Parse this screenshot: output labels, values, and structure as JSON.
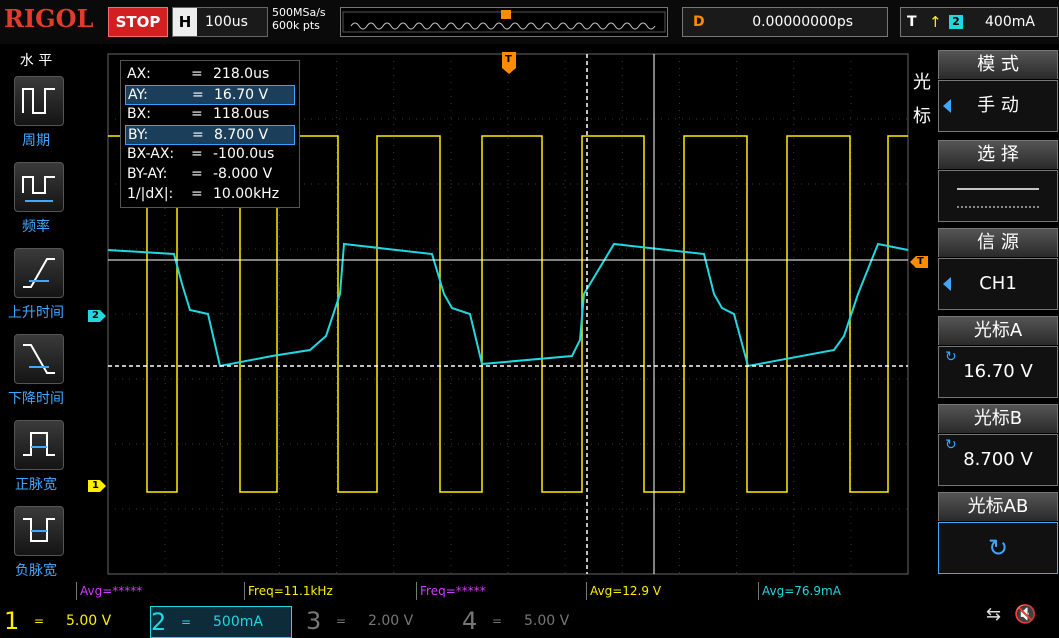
{
  "brand": {
    "logo": "RIGOL"
  },
  "top": {
    "run_state": "STOP",
    "horizontal_label": "H",
    "timebase": "100us",
    "sample_rate": "500MSa/s",
    "memory_depth": "600k pts",
    "delay_label": "D",
    "delay_value": "0.00000000ps",
    "trigger_label": "T",
    "trigger_channel": "2",
    "trigger_level": "400mA",
    "trigger_edge_icon": "rising-edge-icon"
  },
  "left_panel": {
    "title": "水 平",
    "items": [
      {
        "label": "周期",
        "icon": "period-icon"
      },
      {
        "label": "频率",
        "icon": "frequency-icon"
      },
      {
        "label": "上升时间",
        "icon": "rise-time-icon"
      },
      {
        "label": "下降时间",
        "icon": "fall-time-icon"
      },
      {
        "label": "正脉宽",
        "icon": "positive-width-icon"
      },
      {
        "label": "负脉宽",
        "icon": "negative-width-icon"
      }
    ]
  },
  "cursor_readout": [
    {
      "key": "AX:",
      "value": "218.0us",
      "selected": false
    },
    {
      "key": "AY:",
      "value": "16.70 V",
      "selected": true
    },
    {
      "key": "BX:",
      "value": "118.0us",
      "selected": false
    },
    {
      "key": "BY:",
      "value": "8.700 V",
      "selected": true
    },
    {
      "key": "BX-AX:",
      "value": "-100.0us",
      "selected": false
    },
    {
      "key": "BY-AY:",
      "value": "-8.000 V",
      "selected": false
    },
    {
      "key": "1/|dX|:",
      "value": "10.00kHz",
      "selected": false
    }
  ],
  "right_panel": {
    "vertical_label": "光标",
    "mode_title": "模 式",
    "mode_value": "手 动",
    "select_title": "选 择",
    "source_title": "信 源",
    "source_value": "CH1",
    "cursor_a_title": "光标A",
    "cursor_a_value": "16.70 V",
    "cursor_b_title": "光标B",
    "cursor_b_value": "8.700 V",
    "cursor_ab_title": "光标AB"
  },
  "measurements": [
    {
      "text": "Avg=*****",
      "color": "#d23cff"
    },
    {
      "text": "Freq=11.1kHz",
      "color": "#ffee00"
    },
    {
      "text": "Freq=*****",
      "color": "#d23cff"
    },
    {
      "text": "Avg=12.9 V",
      "color": "#ffee00"
    },
    {
      "text": "Avg=76.9mA",
      "color": "#21d7e0"
    }
  ],
  "channels": [
    {
      "num": "1",
      "coupling": "=",
      "scale": "5.00 V",
      "color": "#ffee00",
      "active": true
    },
    {
      "num": "2",
      "coupling": "=",
      "scale": "500mA",
      "color": "#21d7e0",
      "active": true
    },
    {
      "num": "3",
      "coupling": "=",
      "scale": "2.00 V",
      "color": "#777777",
      "active": false
    },
    {
      "num": "4",
      "coupling": "=",
      "scale": "5.00 V",
      "color": "#777777",
      "active": false
    }
  ],
  "markers": {
    "ch1": "1",
    "ch2": "2",
    "trigger": "T"
  },
  "colors": {
    "ch1": "#ffee00",
    "ch2": "#21d7e0",
    "trigger": "#ff8c00",
    "accent": "#40a7ff",
    "stop": "#d21f1f"
  }
}
